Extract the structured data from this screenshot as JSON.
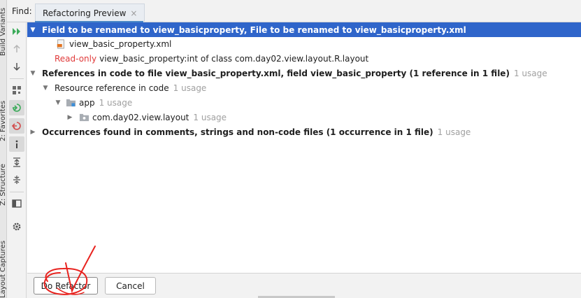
{
  "side_tabs": [
    "Build Variants",
    "2: Favorites",
    "Z: Structure",
    "Layout Captures"
  ],
  "find_bar": {
    "label": "Find:",
    "tab_label": "Refactoring Preview",
    "tab_close": "×"
  },
  "toolbar": {
    "buttons": [
      "rerun-icon",
      "up-arrow-icon",
      "down-arrow-icon",
      "group-icon",
      "import-icon",
      "export-icon",
      "info-icon",
      "expand-all-icon",
      "collapse-all-icon",
      "preview-icon",
      "settings-icon"
    ]
  },
  "tree": {
    "rows": [
      {
        "text": "Field to be renamed to view_basicproperty, File to be renamed to view_basicproperty.xml"
      },
      {
        "text": "view_basic_property.xml"
      },
      {
        "prefix": "Read-only",
        "text": "view_basic_property:int of class com.day02.view.layout.R.layout"
      },
      {
        "text": "References in code to file view_basic_property.xml, field view_basic_property (1 reference in 1 file)",
        "usage": "1 usage"
      },
      {
        "text": "Resource reference in code",
        "usage": "1 usage"
      },
      {
        "text": "app",
        "usage": "1 usage"
      },
      {
        "text": "com.day02.view.layout",
        "usage": "1 usage"
      },
      {
        "text": "Occurrences found in comments, strings and non-code files  (1 occurrence in 1 file)",
        "usage": "1 usage"
      }
    ]
  },
  "buttons": {
    "do_refactor": "Do Refactor",
    "cancel": "Cancel"
  },
  "colors": {
    "selection": "#2f65ca",
    "readonly": "#e03a3a",
    "usage": "#a0a0a0",
    "annotation": "#e8231f"
  }
}
